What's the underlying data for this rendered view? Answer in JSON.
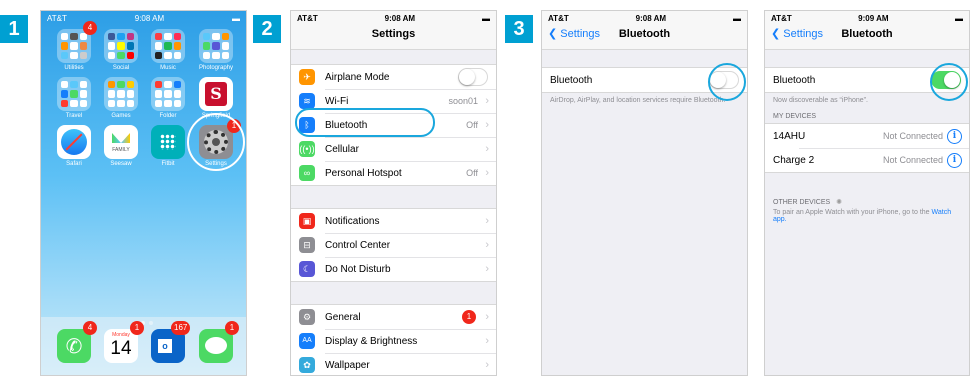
{
  "steps": [
    "1",
    "2",
    "3"
  ],
  "status": {
    "carrier": "AT&T",
    "time1": "9:08 AM",
    "time2": "9:08 AM",
    "time3": "9:08 AM",
    "time4": "9:09 AM"
  },
  "home": {
    "apps": [
      {
        "label": "Utilities"
      },
      {
        "label": "Social"
      },
      {
        "label": "Music"
      },
      {
        "label": "Photography"
      },
      {
        "label": "Travel"
      },
      {
        "label": "Games"
      },
      {
        "label": "Folder"
      },
      {
        "label": "Springfield"
      },
      {
        "label": "Safari"
      },
      {
        "label": "Seesaw"
      },
      {
        "label": "Fitbit"
      },
      {
        "label": "Settings"
      }
    ],
    "badges": {
      "utilities": "4",
      "settings": "1",
      "phone": "4",
      "calendar": "1",
      "outlook": "167",
      "messages": "1"
    },
    "calendar_day": "Monday",
    "calendar_date": "14",
    "seesaw_text": "FAMILY"
  },
  "settings": {
    "title": "Settings",
    "rows1": [
      {
        "label": "Airplane Mode",
        "icon": "airplane-icon",
        "color": "#ff9500"
      },
      {
        "label": "Wi-Fi",
        "value": "soon01",
        "icon": "wifi-icon",
        "color": "#157efb"
      },
      {
        "label": "Bluetooth",
        "value": "Off",
        "icon": "bluetooth-icon",
        "color": "#157efb"
      },
      {
        "label": "Cellular",
        "icon": "cellular-icon",
        "color": "#4cd964"
      },
      {
        "label": "Personal Hotspot",
        "value": "Off",
        "icon": "hotspot-icon",
        "color": "#4cd964"
      }
    ],
    "rows2": [
      {
        "label": "Notifications",
        "icon": "notifications-icon",
        "color": "#f0271b"
      },
      {
        "label": "Control Center",
        "icon": "control-center-icon",
        "color": "#8e8e93"
      },
      {
        "label": "Do Not Disturb",
        "icon": "moon-icon",
        "color": "#5856d6"
      }
    ],
    "rows3": [
      {
        "label": "General",
        "badge": "1",
        "icon": "gear-icon",
        "color": "#8e8e93"
      },
      {
        "label": "Display & Brightness",
        "icon": "display-icon",
        "color": "#157efb"
      },
      {
        "label": "Wallpaper",
        "icon": "wallpaper-icon",
        "color": "#34aadc"
      }
    ]
  },
  "bt_off": {
    "back": "Settings",
    "title": "Bluetooth",
    "row_label": "Bluetooth",
    "footer": "AirDrop, AirPlay, and location services require Bluetooth."
  },
  "bt_on": {
    "back": "Settings",
    "title": "Bluetooth",
    "row_label": "Bluetooth",
    "discoverable": "Now discoverable as “iPhone”.",
    "my_devices_header": "MY DEVICES",
    "devices": [
      {
        "name": "14AHU",
        "status": "Not Connected"
      },
      {
        "name": "Charge 2",
        "status": "Not Connected"
      }
    ],
    "other_header": "OTHER DEVICES",
    "watch_text": "To pair an Apple Watch with your iPhone, go to the",
    "watch_link": "Watch app."
  }
}
